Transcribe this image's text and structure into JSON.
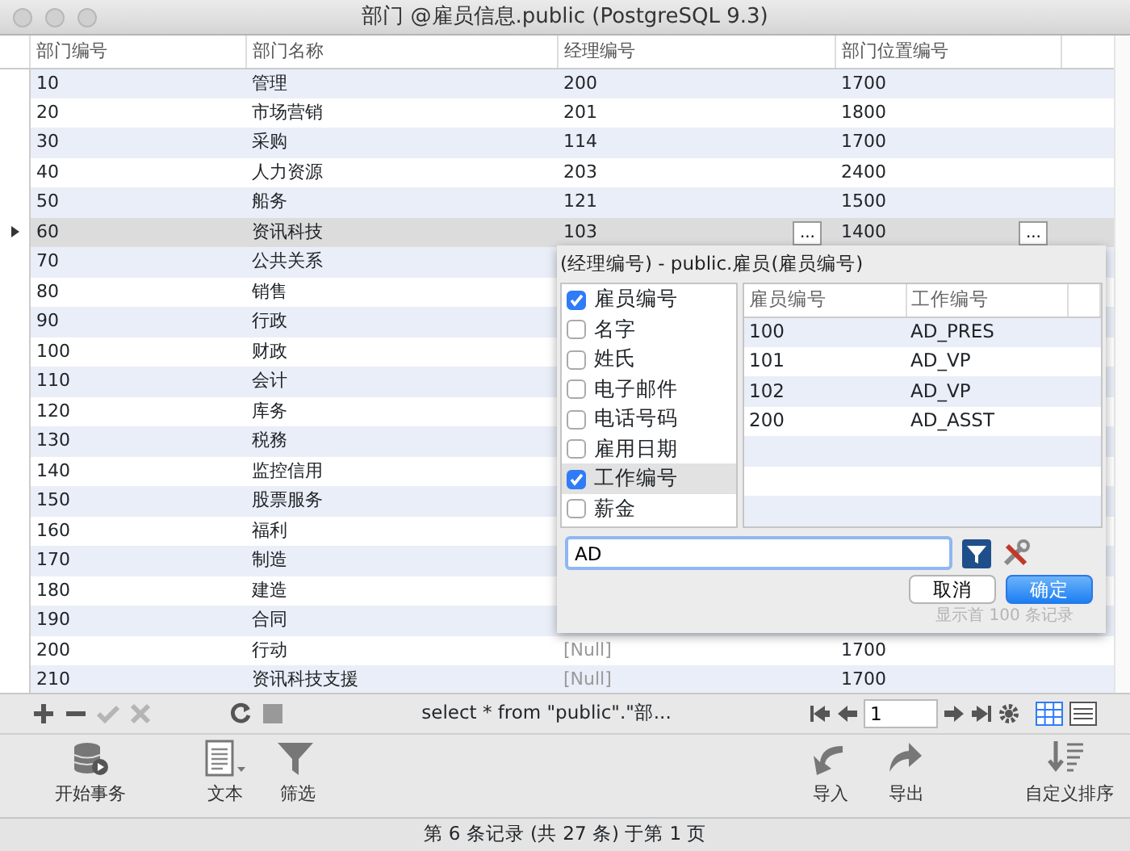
{
  "window": {
    "title": "部门 @雇员信息.public (PostgreSQL 9.3)"
  },
  "table": {
    "columns": [
      "部门编号",
      "部门名称",
      "经理编号",
      "部门位置编号"
    ],
    "rows": [
      {
        "cells": [
          "10",
          "管理",
          "200",
          "1700"
        ],
        "selected": false
      },
      {
        "cells": [
          "20",
          "市场营销",
          "201",
          "1800"
        ],
        "selected": false
      },
      {
        "cells": [
          "30",
          "采购",
          "114",
          "1700"
        ],
        "selected": false
      },
      {
        "cells": [
          "40",
          "人力资源",
          "203",
          "2400"
        ],
        "selected": false
      },
      {
        "cells": [
          "50",
          "船务",
          "121",
          "1500"
        ],
        "selected": false
      },
      {
        "cells": [
          "60",
          "资讯科技",
          "103",
          "1400"
        ],
        "selected": true,
        "cell_button": "..."
      },
      {
        "cells": [
          "70",
          "公共关系"
        ],
        "selected": false
      },
      {
        "cells": [
          "80",
          "销售"
        ],
        "selected": false
      },
      {
        "cells": [
          "90",
          "行政"
        ],
        "selected": false
      },
      {
        "cells": [
          "100",
          "财政"
        ],
        "selected": false
      },
      {
        "cells": [
          "110",
          "会计"
        ],
        "selected": false
      },
      {
        "cells": [
          "120",
          "库务"
        ],
        "selected": false
      },
      {
        "cells": [
          "130",
          "税務"
        ],
        "selected": false
      },
      {
        "cells": [
          "140",
          "监控信用"
        ],
        "selected": false
      },
      {
        "cells": [
          "150",
          "股票服务"
        ],
        "selected": false
      },
      {
        "cells": [
          "160",
          "福利"
        ],
        "selected": false
      },
      {
        "cells": [
          "170",
          "制造"
        ],
        "selected": false
      },
      {
        "cells": [
          "180",
          "建造"
        ],
        "selected": false
      },
      {
        "cells": [
          "190",
          "合同"
        ],
        "selected": false
      },
      {
        "cells": [
          "200",
          "行动",
          {
            "text": "[Null]",
            "kind": "null"
          },
          "1700"
        ],
        "selected": false
      },
      {
        "cells": [
          "210",
          "资讯科技支援",
          {
            "text": "[Null]",
            "kind": "null"
          },
          "1700"
        ],
        "selected": false
      }
    ]
  },
  "lookup_popup": {
    "title": "(经理编号) - public.雇员(雇员编号)",
    "fields": [
      {
        "label": "雇员编号",
        "checked": true,
        "selected": false
      },
      {
        "label": "名字",
        "checked": false,
        "selected": false
      },
      {
        "label": "姓氏",
        "checked": false,
        "selected": false
      },
      {
        "label": "电子邮件",
        "checked": false,
        "selected": false
      },
      {
        "label": "电话号码",
        "checked": false,
        "selected": false
      },
      {
        "label": "雇用日期",
        "checked": false,
        "selected": false
      },
      {
        "label": "工作编号",
        "checked": true,
        "selected": true
      },
      {
        "label": "薪金",
        "checked": false,
        "selected": false
      }
    ],
    "results": {
      "columns": [
        "雇员编号",
        "工作编号"
      ],
      "rows": [
        [
          "100",
          "AD_PRES"
        ],
        [
          "101",
          "AD_VP"
        ],
        [
          "102",
          "AD_VP"
        ],
        [
          "200",
          "AD_ASST"
        ]
      ]
    },
    "filter": {
      "value": "AD"
    },
    "buttons": [
      {
        "label": "取消",
        "primary": false
      },
      {
        "label": "确定",
        "primary": true
      }
    ],
    "note": "显示首 100 条记录"
  },
  "toolbar": {
    "query": "select * from \"public\".\"部...",
    "page": "1"
  },
  "bottom_toolbar": [
    {
      "label": "开始事务",
      "kind": "transaction"
    },
    {
      "label": "文本",
      "kind": "text"
    },
    {
      "label": "筛选",
      "kind": "filter"
    },
    {
      "label": "导入",
      "kind": "import"
    },
    {
      "label": "导出",
      "kind": "export"
    },
    {
      "label": "自定义排序",
      "kind": "sort"
    }
  ],
  "status_bar": "第 6 条记录 (共 27 条) 于第 1 页"
}
